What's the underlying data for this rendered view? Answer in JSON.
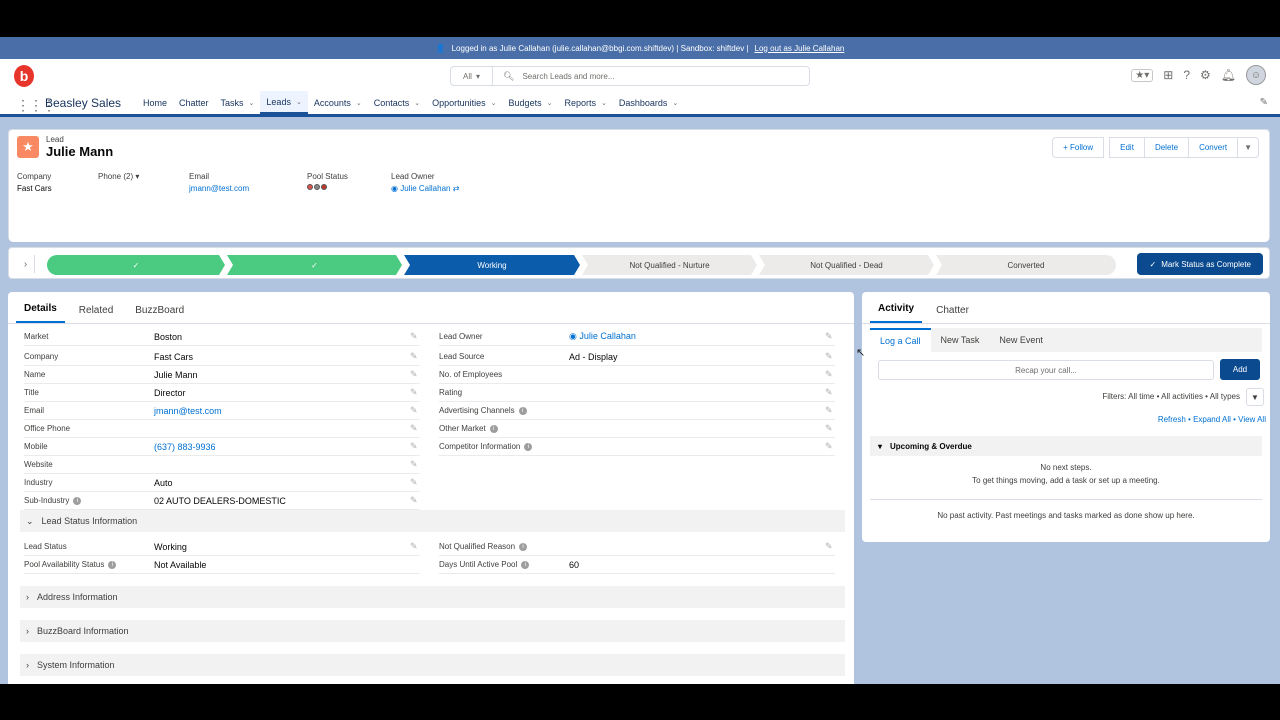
{
  "sandbox_bar": {
    "text": "Logged in as Julie Callahan (julie.callahan@bbgi.com.shiftdev) | Sandbox: shiftdev |",
    "logout": "Log out as Julie Callahan"
  },
  "header": {
    "logo": "b",
    "search_scope": "All",
    "search_placeholder": "Search Leads and more..."
  },
  "nav": {
    "app_name": "Beasley Sales",
    "items": [
      {
        "label": "Home",
        "dropdown": false
      },
      {
        "label": "Chatter",
        "dropdown": false
      },
      {
        "label": "Tasks",
        "dropdown": true
      },
      {
        "label": "Leads",
        "dropdown": true,
        "active": true
      },
      {
        "label": "Accounts",
        "dropdown": true
      },
      {
        "label": "Contacts",
        "dropdown": true
      },
      {
        "label": "Opportunities",
        "dropdown": true
      },
      {
        "label": "Budgets",
        "dropdown": true
      },
      {
        "label": "Reports",
        "dropdown": true
      },
      {
        "label": "Dashboards",
        "dropdown": true
      }
    ]
  },
  "record": {
    "type": "Lead",
    "name": "Julie Mann",
    "actions": {
      "follow": "+ Follow",
      "edit": "Edit",
      "delete": "Delete",
      "convert": "Convert"
    },
    "highlights": {
      "company_label": "Company",
      "company": "Fast Cars",
      "phone_label": "Phone (2)",
      "email_label": "Email",
      "email": "jmann@test.com",
      "pool_label": "Pool Status",
      "owner_label": "Lead Owner",
      "owner": "Julie Callahan"
    }
  },
  "path": {
    "stages": [
      {
        "label": "✓",
        "state": "done"
      },
      {
        "label": "✓",
        "state": "done"
      },
      {
        "label": "Working",
        "state": "current"
      },
      {
        "label": "Not Qualified - Nurture",
        "state": "todo"
      },
      {
        "label": "Not Qualified - Dead",
        "state": "todo"
      },
      {
        "label": "Converted",
        "state": "todo"
      }
    ],
    "mark_button": "Mark Status as Complete"
  },
  "details": {
    "tabs": [
      "Details",
      "Related",
      "BuzzBoard"
    ],
    "left_fields": [
      {
        "label": "Market",
        "value": "Boston"
      },
      {
        "label": "Company",
        "value": "Fast Cars"
      },
      {
        "label": "Name",
        "value": "Julie Mann"
      },
      {
        "label": "Title",
        "value": "Director"
      },
      {
        "label": "Email",
        "value": "jmann@test.com"
      },
      {
        "label": "Office Phone",
        "value": ""
      },
      {
        "label": "Mobile",
        "value": "(637) 883-9936"
      },
      {
        "label": "Website",
        "value": ""
      },
      {
        "label": "Industry",
        "value": "Auto"
      },
      {
        "label": "Sub-Industry",
        "value": "02 AUTO DEALERS-DOMESTIC"
      }
    ],
    "right_fields": [
      {
        "label": "Lead Owner",
        "value": "Julie Callahan"
      },
      {
        "label": "Lead Source",
        "value": "Ad - Display"
      },
      {
        "label": "No. of Employees",
        "value": ""
      },
      {
        "label": "Rating",
        "value": ""
      },
      {
        "label": "Advertising Channels",
        "value": ""
      },
      {
        "label": "Other Market",
        "value": ""
      },
      {
        "label": "Competitor Information",
        "value": ""
      }
    ],
    "lead_status_section": "Lead Status Information",
    "status_fields": [
      {
        "label": "Lead Status",
        "value": "Working"
      },
      {
        "label": "Pool Availability Status",
        "value": "Not Available"
      },
      {
        "label": "Not Qualified Reason",
        "value": ""
      },
      {
        "label": "Days Until Active Pool",
        "value": "60"
      }
    ],
    "sections": [
      "Address Information",
      "BuzzBoard Information",
      "System Information"
    ]
  },
  "activity": {
    "tabs": [
      "Activity",
      "Chatter"
    ],
    "subtabs": [
      "Log a Call",
      "New Task",
      "New Event"
    ],
    "recap_placeholder": "Recap your call...",
    "add": "Add",
    "filters": "Filters: All time • All activities • All types",
    "refresh_links": "Refresh • Expand All • View All",
    "upcoming": "Upcoming & Overdue",
    "no_next": "No next steps.",
    "no_next_sub": "To get things moving, add a task or set up a meeting.",
    "no_past": "No past activity. Past meetings and tasks marked as done show up here."
  }
}
